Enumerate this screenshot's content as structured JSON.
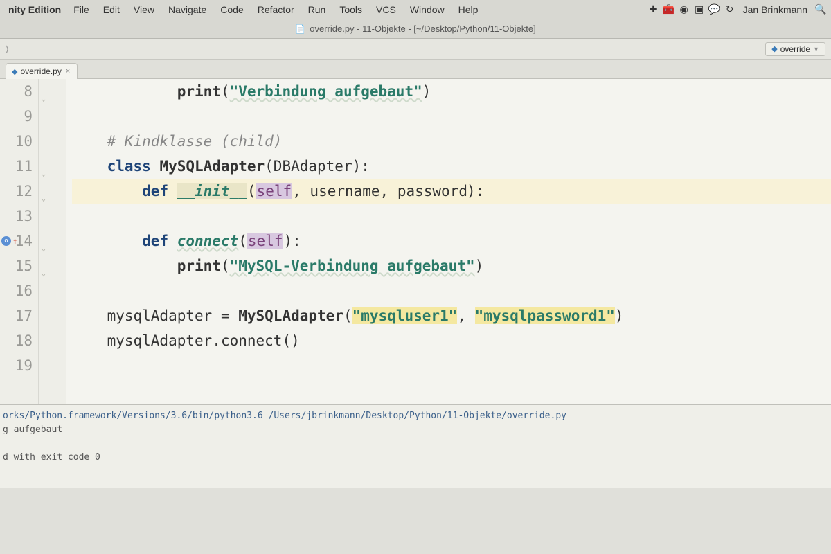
{
  "menubar": {
    "app_name": "nity Edition",
    "items": [
      "File",
      "Edit",
      "View",
      "Navigate",
      "Code",
      "Refactor",
      "Run",
      "Tools",
      "VCS",
      "Window",
      "Help"
    ],
    "status_icons": [
      "plus-icon",
      "toolbox-icon",
      "circle-check-icon",
      "record-icon",
      "chat-icon",
      "history-icon"
    ],
    "user": "Jan Brinkmann",
    "search_icon": "search-icon"
  },
  "titlebar": {
    "text": "override.py - 11-Objekte - [~/Desktop/Python/11-Objekte]"
  },
  "toolbar": {
    "breadcrumb_sep": "⟩",
    "run_config_label": "override"
  },
  "tabs": [
    {
      "filename": "override.py",
      "active": true
    }
  ],
  "gutter": {
    "start": 8,
    "end": 19,
    "override_line": 14
  },
  "code": {
    "lines": [
      {
        "n": 8,
        "indent": "            ",
        "tokens": [
          {
            "t": "print",
            "c": "call"
          },
          {
            "t": "(",
            "c": ""
          },
          {
            "t": "\"Verbindung aufgebaut\"",
            "c": "str"
          },
          {
            "t": ")",
            "c": ""
          }
        ]
      },
      {
        "n": 9,
        "indent": "",
        "tokens": []
      },
      {
        "n": 10,
        "indent": "    ",
        "tokens": [
          {
            "t": "# Kindklasse (child)",
            "c": "comment"
          }
        ]
      },
      {
        "n": 11,
        "indent": "    ",
        "tokens": [
          {
            "t": "class ",
            "c": "kw"
          },
          {
            "t": "MySQLAdapter",
            "c": "cls"
          },
          {
            "t": "(DBAdapter):",
            "c": ""
          }
        ]
      },
      {
        "n": 12,
        "indent": "        ",
        "current": true,
        "tokens": [
          {
            "t": "def ",
            "c": "def"
          },
          {
            "t": "__init__",
            "c": "dunder"
          },
          {
            "t": "(",
            "c": ""
          },
          {
            "t": "self",
            "c": "self"
          },
          {
            "t": ", username, password",
            "c": "param"
          },
          {
            "cursor": true
          },
          {
            "t": "):",
            "c": ""
          }
        ]
      },
      {
        "n": 13,
        "indent": "",
        "tokens": []
      },
      {
        "n": 14,
        "indent": "        ",
        "tokens": [
          {
            "t": "def ",
            "c": "def"
          },
          {
            "t": "connect",
            "c": "fname"
          },
          {
            "t": "(",
            "c": ""
          },
          {
            "t": "self",
            "c": "self"
          },
          {
            "t": "):",
            "c": ""
          }
        ]
      },
      {
        "n": 15,
        "indent": "            ",
        "tokens": [
          {
            "t": "print",
            "c": "call"
          },
          {
            "t": "(",
            "c": ""
          },
          {
            "t": "\"MySQL-Verbindung aufgebaut\"",
            "c": "str"
          },
          {
            "t": ")",
            "c": ""
          }
        ]
      },
      {
        "n": 16,
        "indent": "",
        "tokens": []
      },
      {
        "n": 17,
        "indent": "    ",
        "tokens": [
          {
            "t": "mysqlAdapter = ",
            "c": "ident"
          },
          {
            "t": "MySQLAdapter",
            "c": "call"
          },
          {
            "t": "(",
            "c": ""
          },
          {
            "t": "\"mysqluser1\"",
            "c": "strhl"
          },
          {
            "t": ", ",
            "c": ""
          },
          {
            "t": "\"mysqlpassword1\"",
            "c": "strhl"
          },
          {
            "t": ")",
            "c": ""
          }
        ]
      },
      {
        "n": 18,
        "indent": "    ",
        "tokens": [
          {
            "t": "mysqlAdapter.connect()",
            "c": "ident"
          }
        ]
      },
      {
        "n": 19,
        "indent": "",
        "tokens": []
      }
    ]
  },
  "console": {
    "cmd": "orks/Python.framework/Versions/3.6/bin/python3.6 /Users/jbrinkmann/Desktop/Python/11-Objekte/override.py",
    "out1": "g aufgebaut",
    "out2": "d with exit code 0"
  }
}
